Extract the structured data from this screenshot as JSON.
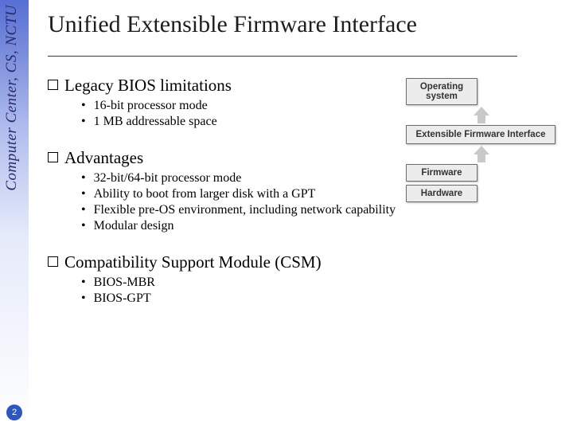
{
  "sidebar_text": "Computer Center, CS, NCTU",
  "page_number": "2",
  "title": "Unified Extensible Firmware Interface",
  "sections": [
    {
      "heading": "Legacy BIOS limitations",
      "bullets": [
        "16-bit processor mode",
        "1 MB addressable space"
      ]
    },
    {
      "heading": "Advantages",
      "bullets": [
        "32-bit/64-bit processor mode",
        "Ability to boot from larger disk with a GPT",
        "Flexible pre-OS environment, including network capability",
        "Modular design"
      ]
    },
    {
      "heading": "Compatibility Support Module (CSM)",
      "bullets": [
        "BIOS-MBR",
        "BIOS-GPT"
      ]
    }
  ],
  "diagram": {
    "layers": [
      "Operating system",
      "Extensible Firmware Interface",
      "Firmware",
      "Hardware"
    ]
  }
}
